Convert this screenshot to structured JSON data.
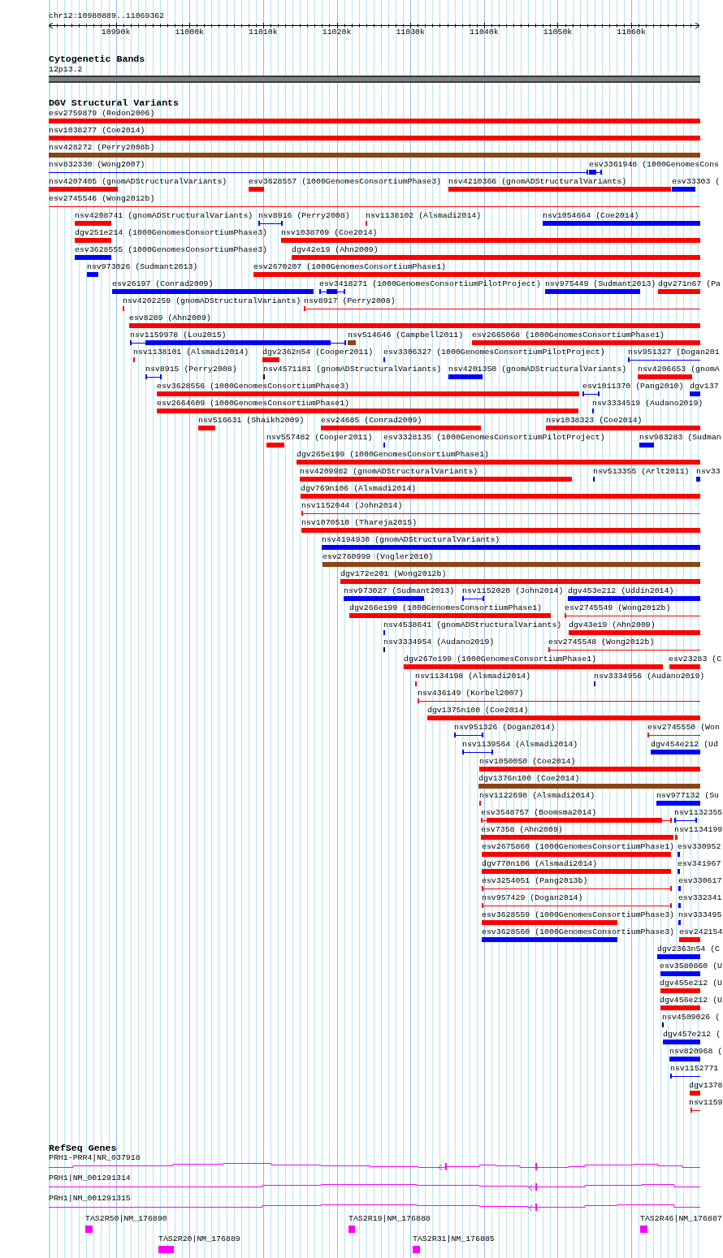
{
  "region": "chr12:10980889..11069362",
  "ruler": {
    "ticks": [
      "10990k",
      "11000k",
      "11010k",
      "11020k",
      "11030k",
      "11040k",
      "11050k",
      "11060k"
    ]
  },
  "tracks": [
    {
      "kind": "cytoband",
      "title": "Cytogenetic Bands",
      "bands": [
        {
          "label": "12p13.2"
        }
      ]
    },
    {
      "kind": "variants",
      "title": "DGV Structural Variants",
      "features": [
        {
          "label": "esv2759879 (Redon2006)",
          "color": "#ff0000",
          "kind": "bar"
        },
        {
          "label": "nsv1038277 (Coe2014)",
          "color": "#ff0000",
          "kind": "bar"
        },
        {
          "label": "nsv428272 (Perry2008b)",
          "color": "#8b4513",
          "kind": "bar"
        },
        {
          "label": "nsv832330 (Wong2007)",
          "color": "#0000ff",
          "kind": "line"
        },
        {
          "label": "esv3361948 (1000GenomesCons",
          "color": "#0000ff",
          "kind": "split"
        },
        {
          "label": "nsv4207405 (gnomADStructuralVariants)",
          "color": "#ff0000",
          "kind": "bar"
        },
        {
          "label": "esv3628557 (1000GenomesConsortiumPhase3)",
          "color": "#ff0000",
          "kind": "bar"
        },
        {
          "label": "nsv4210366 (gnomADStructuralVariants)",
          "color": "#ff0000",
          "kind": "bar"
        },
        {
          "label": "esv33303 (",
          "color": "#0000ff",
          "kind": "bar"
        },
        {
          "label": "esv2745546 (Wong2012b)",
          "color": "#ff0000",
          "kind": "line"
        },
        {
          "label": "nsv4208741 (gnomADStructuralVariants)",
          "color": "#ff0000",
          "kind": "bar"
        },
        {
          "label": "nsv8916 (Perry2008)",
          "color": "#0000ff",
          "kind": "line"
        },
        {
          "label": "nsv1138102 (Alsmadi2014)",
          "color": "#ff0000",
          "kind": "bar"
        },
        {
          "label": "nsv1054664 (Coe2014)",
          "color": "#0000ff",
          "kind": "bar"
        },
        {
          "label": "dgv251e214 (1000GenomesConsortiumPhase3)",
          "color": "#ff0000",
          "kind": "bar"
        },
        {
          "label": "nsv1038709 (Coe2014)",
          "color": "#ff0000",
          "kind": "bar"
        },
        {
          "label": "esv3628555 (1000GenomesConsortiumPhase3)",
          "color": "#0000ff",
          "kind": "bar"
        },
        {
          "label": "dgv42e19 (Ahn2009)",
          "color": "#ff0000",
          "kind": "bar"
        },
        {
          "label": "nsv973026 (Sudmant2013)",
          "color": "#0000ff",
          "kind": "bar"
        },
        {
          "label": "esv2670207 (1000GenomesConsortiumPhase1)",
          "color": "#ff0000",
          "kind": "bar"
        },
        {
          "label": "esv26197 (Conrad2009)",
          "color": "#0000ff",
          "kind": "bar"
        },
        {
          "label": "esv3418271 (1000GenomesConsortiumPilotProject)",
          "color": "#0000ff",
          "kind": "split"
        },
        {
          "label": "nsv975449 (Sudmant2013)",
          "color": "#0000ff",
          "kind": "bar"
        },
        {
          "label": "dgv271n67 (Pa",
          "color": "#ff0000",
          "kind": "bar"
        },
        {
          "label": "nsv4202259 (gnomADStructuralVariants)",
          "color": "#ff0000",
          "kind": "bar"
        },
        {
          "label": "nsv8917 (Perry2008)",
          "color": "#ff0000",
          "kind": "line"
        },
        {
          "label": "esv8289 (Ahn2009)",
          "color": "#ff0000",
          "kind": "bar"
        },
        {
          "label": "nsv1159978 (Lou2015)",
          "color": "#0000ff",
          "kind": "split"
        },
        {
          "label": "nsv514646 (Campbell2011)",
          "color": "#8b4513",
          "kind": "bar"
        },
        {
          "label": "esv2665068 (1000GenomesConsortiumPhase1)",
          "color": "#ff0000",
          "kind": "bar"
        },
        {
          "label": "nsv1138101 (Alsmadi2014)",
          "color": "#ff0000",
          "kind": "bar"
        },
        {
          "label": "dgv2362n54 (Cooper2011)",
          "color": "#ff0000",
          "kind": "bar"
        },
        {
          "label": "esv3306327 (1000GenomesConsortiumPilotProject)",
          "color": "#0000ff",
          "kind": "bar"
        },
        {
          "label": "nsv951327 (Dogan201",
          "color": "#0000ff",
          "kind": "line"
        },
        {
          "label": "nsv8915 (Perry2008)",
          "color": "#0000ff",
          "kind": "line"
        },
        {
          "label": "nsv4571181 (gnomADStructuralVariants)",
          "color": "#000000",
          "kind": "bar"
        },
        {
          "label": "nsv4201350 (gnomADStructuralVariants)",
          "color": "#0000ff",
          "kind": "bar"
        },
        {
          "label": "nsv4206653 (gnomA",
          "color": "#ff0000",
          "kind": "bar"
        },
        {
          "label": "esv3628556 (1000GenomesConsortiumPhase3)",
          "color": "#ff0000",
          "kind": "bar"
        },
        {
          "label": "esv1011370 (Pang2010)",
          "color": "#0000ff",
          "kind": "line"
        },
        {
          "label": "dgv137",
          "color": "#0000ff",
          "kind": "bar"
        },
        {
          "label": "esv2664609 (1000GenomesConsortiumPhase1)",
          "color": "#ff0000",
          "kind": "bar"
        },
        {
          "label": "nsv3334519 (Audano2019)",
          "color": "#0000ff",
          "kind": "bar"
        },
        {
          "label": "nsv516631 (Shaikh2009)",
          "color": "#ff0000",
          "kind": "bar"
        },
        {
          "label": "esv24685 (Conrad2009)",
          "color": "#ff0000",
          "kind": "bar"
        },
        {
          "label": "nsv1038323 (Coe2014)",
          "color": "#ff0000",
          "kind": "bar"
        },
        {
          "label": "nsv557482 (Cooper2011)",
          "color": "#ff0000",
          "kind": "bar"
        },
        {
          "label": "esv3328135 (1000GenomesConsortiumPilotProject)",
          "color": "#0000ff",
          "kind": "bar"
        },
        {
          "label": "nsv983283 (Sudman",
          "color": "#0000ff",
          "kind": "bar"
        },
        {
          "label": "dgv265e199 (1000GenomesConsortiumPhase1)",
          "color": "#ff0000",
          "kind": "bar"
        },
        {
          "label": "nsv4209982 (gnomADStructuralVariants)",
          "color": "#ff0000",
          "kind": "bar"
        },
        {
          "label": "nsv513355 (Arlt2011)",
          "color": "#0000ff",
          "kind": "bar"
        },
        {
          "label": "nsv33",
          "color": "#0000ff",
          "kind": "bar"
        },
        {
          "label": "dgv769n106 (Alsmadi2014)",
          "color": "#ff0000",
          "kind": "bar"
        },
        {
          "label": "nsv1152044 (John2014)",
          "color": "#ff0000",
          "kind": "line"
        },
        {
          "label": "nsv1070510 (Thareja2015)",
          "color": "#ff0000",
          "kind": "bar"
        },
        {
          "label": "nsv4194930 (gnomADStructuralVariants)",
          "color": "#0000ff",
          "kind": "bar"
        },
        {
          "label": "esv2760999 (Vogler2010)",
          "color": "#8b4513",
          "kind": "bar"
        },
        {
          "label": "dgv172e201 (Wong2012b)",
          "color": "#ff0000",
          "kind": "bar"
        },
        {
          "label": "nsv973027 (Sudmant2013)",
          "color": "#0000ff",
          "kind": "bar"
        },
        {
          "label": "nsv1152020 (John2014)",
          "color": "#0000ff",
          "kind": "line"
        },
        {
          "label": "dgv453e212 (Uddin2014)",
          "color": "#0000ff",
          "kind": "bar"
        },
        {
          "label": "dgv266e199 (1000GenomesConsortiumPhase1)",
          "color": "#ff0000",
          "kind": "bar"
        },
        {
          "label": "esv2745549 (Wong2012b)",
          "color": "#ff0000",
          "kind": "line"
        },
        {
          "label": "nsv4538641 (gnomADStructuralVariants)",
          "color": "#0000ff",
          "kind": "bar"
        },
        {
          "label": "dgv43e19 (Ahn2009)",
          "color": "#ff0000",
          "kind": "bar"
        },
        {
          "label": "nsv3334954 (Audano2019)",
          "color": "#000000",
          "kind": "bar"
        },
        {
          "label": "esv2745548 (Wong2012b)",
          "color": "#ff0000",
          "kind": "line"
        },
        {
          "label": "dgv267e199 (1000GenomesConsortiumPhase1)",
          "color": "#ff0000",
          "kind": "bar"
        },
        {
          "label": "esv23283 (C",
          "color": "#ff0000",
          "kind": "bar"
        },
        {
          "label": "nsv1134198 (Alsmadi2014)",
          "color": "#ff0000",
          "kind": "bar"
        },
        {
          "label": "nsv3334956 (Audano2019)",
          "color": "#0000ff",
          "kind": "bar"
        },
        {
          "label": "nsv436149 (Korbel2007)",
          "color": "#ff0000",
          "kind": "line"
        },
        {
          "label": "dgv1375n100 (Coe2014)",
          "color": "#ff0000",
          "kind": "bar"
        },
        {
          "label": "nsv951326 (Dogan2014)",
          "color": "#0000ff",
          "kind": "line"
        },
        {
          "label": "esv2745550 (Won",
          "color": "#ff0000",
          "kind": "line"
        },
        {
          "label": "nsv1139564 (Alsmadi2014)",
          "color": "#0000ff",
          "kind": "line"
        },
        {
          "label": "dgv454e212 (Ud",
          "color": "#0000ff",
          "kind": "bar"
        },
        {
          "label": "nsv1050050 (Coe2014)",
          "color": "#ff0000",
          "kind": "bar"
        },
        {
          "label": "dgv1376n100 (Coe2014)",
          "color": "#8b4513",
          "kind": "bar"
        },
        {
          "label": "nsv1122698 (Alsmadi2014)",
          "color": "#ff0000",
          "kind": "bar"
        },
        {
          "label": "nsv977132 (Su",
          "color": "#0000ff",
          "kind": "bar"
        },
        {
          "label": "esv3548757 (Boomsma2014)",
          "color": "#ff0000",
          "kind": "split"
        },
        {
          "label": "nsv1132355",
          "color": "#0000ff",
          "kind": "line"
        },
        {
          "label": "esv7358 (Ahn2009)",
          "color": "#ff0000",
          "kind": "bar"
        },
        {
          "label": "nsv1134199",
          "color": "#ff0000",
          "kind": "bar"
        },
        {
          "label": "esv2675860 (1000GenomesConsortiumPhase1)",
          "color": "#ff0000",
          "kind": "bar"
        },
        {
          "label": "esv330952",
          "color": "#0000ff",
          "kind": "bar"
        },
        {
          "label": "dgv770n106 (Alsmadi2014)",
          "color": "#ff0000",
          "kind": "bar"
        },
        {
          "label": "esv341967",
          "color": "#0000ff",
          "kind": "bar"
        },
        {
          "label": "esv3254051 (Pang2013b)",
          "color": "#ff0000",
          "kind": "line"
        },
        {
          "label": "esv330617",
          "color": "#0000ff",
          "kind": "bar"
        },
        {
          "label": "nsv957429 (Dogan2014)",
          "color": "#ff0000",
          "kind": "line"
        },
        {
          "label": "esv332341",
          "color": "#0000ff",
          "kind": "bar"
        },
        {
          "label": "esv3628559 (1000GenomesConsortiumPhase3)",
          "color": "#ff0000",
          "kind": "bar"
        },
        {
          "label": "nsv333495",
          "color": "#0000ff",
          "kind": "bar"
        },
        {
          "label": "esv3628560 (1000GenomesConsortiumPhase3)",
          "color": "#0000ff",
          "kind": "bar"
        },
        {
          "label": "esv242154",
          "color": "#ff0000",
          "kind": "bar"
        },
        {
          "label": "dgv2363n54 (C",
          "color": "#0000ff",
          "kind": "bar"
        },
        {
          "label": "esv3580860 (U",
          "color": "#0000ff",
          "kind": "bar"
        },
        {
          "label": "dgv455e212 (U",
          "color": "#ff0000",
          "kind": "bar"
        },
        {
          "label": "dgv456e212 (U",
          "color": "#ff0000",
          "kind": "bar"
        },
        {
          "label": "nsv4509026 (",
          "color": "#000000",
          "kind": "bar"
        },
        {
          "label": "dgv457e212 (",
          "color": "#0000ff",
          "kind": "bar"
        },
        {
          "label": "nsv820968 (",
          "color": "#0000ff",
          "kind": "bar"
        },
        {
          "label": "nsv1152771",
          "color": "#0000ff",
          "kind": "line"
        },
        {
          "label": "dgv1378",
          "color": "#ff0000",
          "kind": "bar"
        },
        {
          "label": "nsv1159",
          "color": "#ff0000",
          "kind": "line"
        }
      ]
    },
    {
      "kind": "genes",
      "title": "RefSeq Genes",
      "features": [
        {
          "label": "PRH1-PRR4|NR_037918",
          "kind": "transcript"
        },
        {
          "label": "PRH1|NM_001291314",
          "kind": "transcript"
        },
        {
          "label": "PRH1|NM_001291315",
          "kind": "transcript"
        },
        {
          "label": "TAS2R50|NM_176890",
          "kind": "box"
        },
        {
          "label": "TAS2R19|NM_176888",
          "kind": "box"
        },
        {
          "label": "TAS2R46|NM_176887",
          "kind": "box"
        },
        {
          "label": "TAS2R20|NM_176889",
          "kind": "box"
        },
        {
          "label": "TAS2R31|NM_176885",
          "kind": "box"
        }
      ]
    }
  ]
}
